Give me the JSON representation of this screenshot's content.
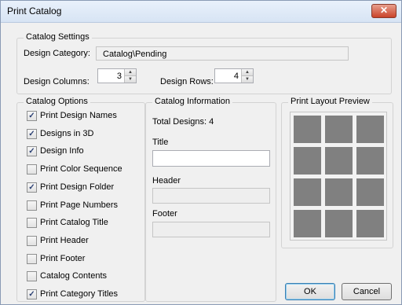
{
  "window": {
    "title": "Print Catalog",
    "close_glyph": "✕"
  },
  "settings": {
    "group_label": "Catalog Settings",
    "category_label": "Design Category:",
    "category_value": "Catalog\\Pending",
    "columns_label": "Design Columns:",
    "columns_value": "3",
    "rows_label": "Design Rows:",
    "rows_value": "4"
  },
  "options": {
    "group_label": "Catalog Options",
    "items": [
      {
        "label": "Print Design Names",
        "checked": true
      },
      {
        "label": "Designs in 3D",
        "checked": true
      },
      {
        "label": "Design Info",
        "checked": true
      },
      {
        "label": "Print Color Sequence",
        "checked": false
      },
      {
        "label": "Print Design Folder",
        "checked": true
      },
      {
        "label": "Print Page Numbers",
        "checked": false
      },
      {
        "label": "Print Catalog Title",
        "checked": false
      },
      {
        "label": "Print Header",
        "checked": false
      },
      {
        "label": "Print Footer",
        "checked": false
      },
      {
        "label": "Catalog Contents",
        "checked": false
      },
      {
        "label": "Print Category Titles",
        "checked": true
      }
    ]
  },
  "info": {
    "group_label": "Catalog Information",
    "total_designs": "Total Designs: 4",
    "title_label": "Title",
    "title_value": "",
    "header_label": "Header",
    "header_value": "",
    "footer_label": "Footer",
    "footer_value": ""
  },
  "preview": {
    "group_label": "Print Layout Preview",
    "columns": 3,
    "rows": 4,
    "cell_color": "#808080"
  },
  "buttons": {
    "ok": "OK",
    "cancel": "Cancel"
  }
}
